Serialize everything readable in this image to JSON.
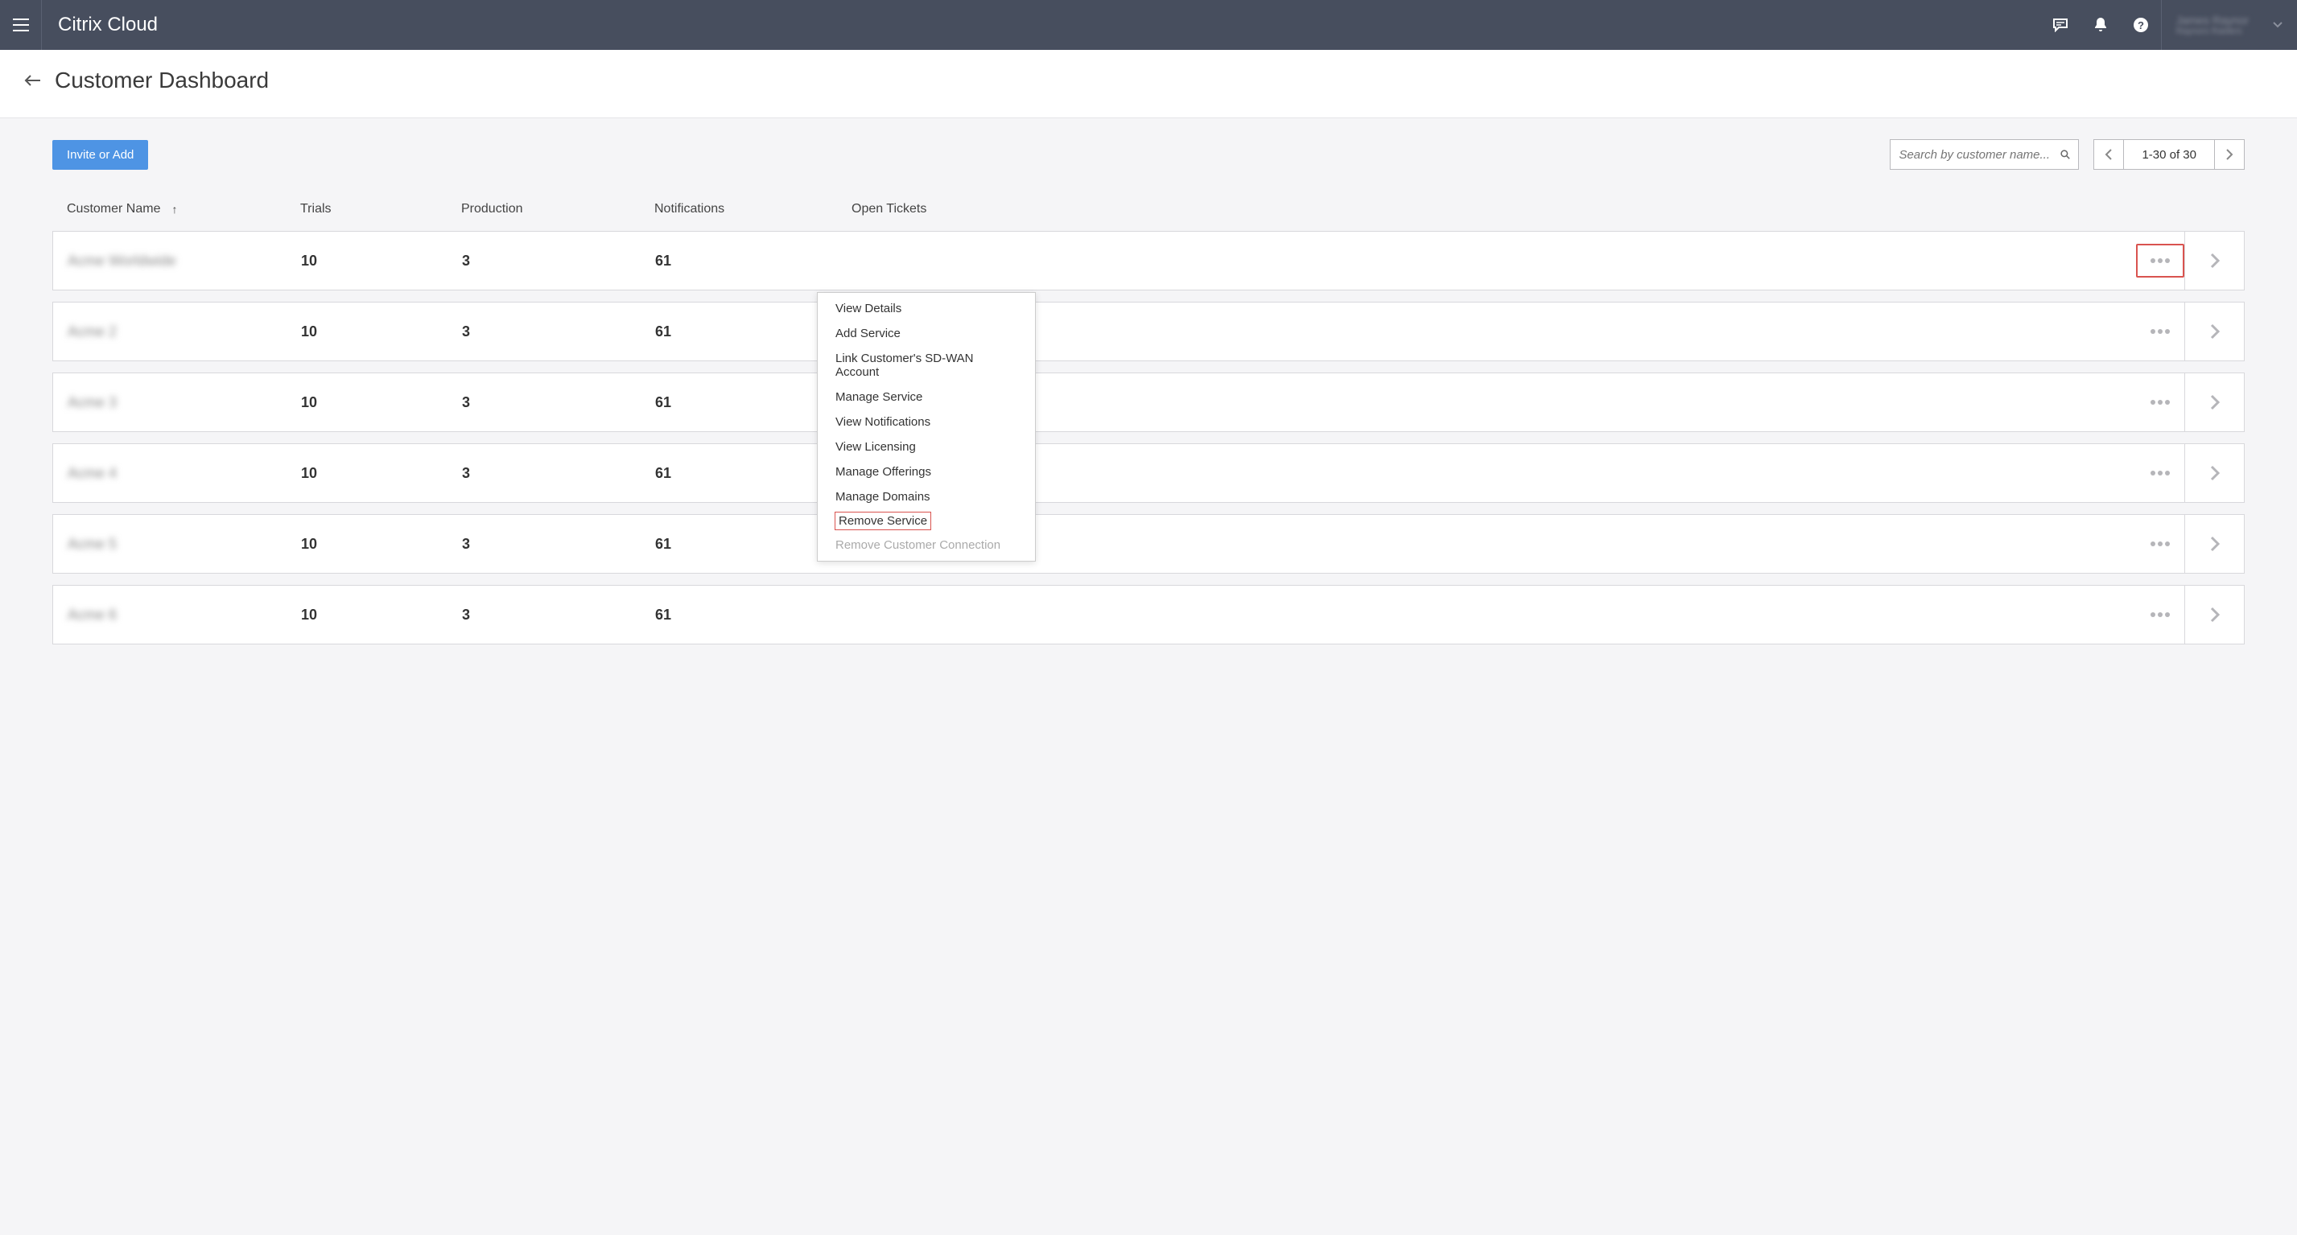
{
  "header": {
    "brand_bold": "Citrix",
    "brand_light": " Cloud",
    "user_name": "James Raynor",
    "user_sub": "Raynors Raiders"
  },
  "page": {
    "title": "Customer Dashboard"
  },
  "toolbar": {
    "invite_label": "Invite or Add",
    "search_placeholder": "Search by customer name...",
    "pager_label": "1-30 of 30"
  },
  "table": {
    "headers": {
      "name": "Customer Name",
      "trials": "Trials",
      "production": "Production",
      "notifications": "Notifications",
      "open_tickets": "Open Tickets"
    },
    "rows": [
      {
        "name": "Acme Worldwide",
        "trials": "10",
        "production": "3",
        "notifications": "61",
        "tickets": "",
        "highlighted": true
      },
      {
        "name": "Acme 2",
        "trials": "10",
        "production": "3",
        "notifications": "61",
        "tickets": ""
      },
      {
        "name": "Acme 3",
        "trials": "10",
        "production": "3",
        "notifications": "61",
        "tickets": ""
      },
      {
        "name": "Acme 4",
        "trials": "10",
        "production": "3",
        "notifications": "61",
        "tickets": ""
      },
      {
        "name": "Acme 5",
        "trials": "10",
        "production": "3",
        "notifications": "61",
        "tickets": ""
      },
      {
        "name": "Acme 6",
        "trials": "10",
        "production": "3",
        "notifications": "61",
        "tickets": ""
      }
    ]
  },
  "dropdown": {
    "items": [
      {
        "label": "View Details"
      },
      {
        "label": "Add Service"
      },
      {
        "label": "Link Customer's SD-WAN Account"
      },
      {
        "label": "Manage Service"
      },
      {
        "label": "View Notifications"
      },
      {
        "label": "View Licensing"
      },
      {
        "label": "Manage Offerings"
      },
      {
        "label": "Manage Domains"
      },
      {
        "label": "Remove Service",
        "highlighted": true
      },
      {
        "label": "Remove Customer Connection",
        "disabled": true
      }
    ]
  }
}
